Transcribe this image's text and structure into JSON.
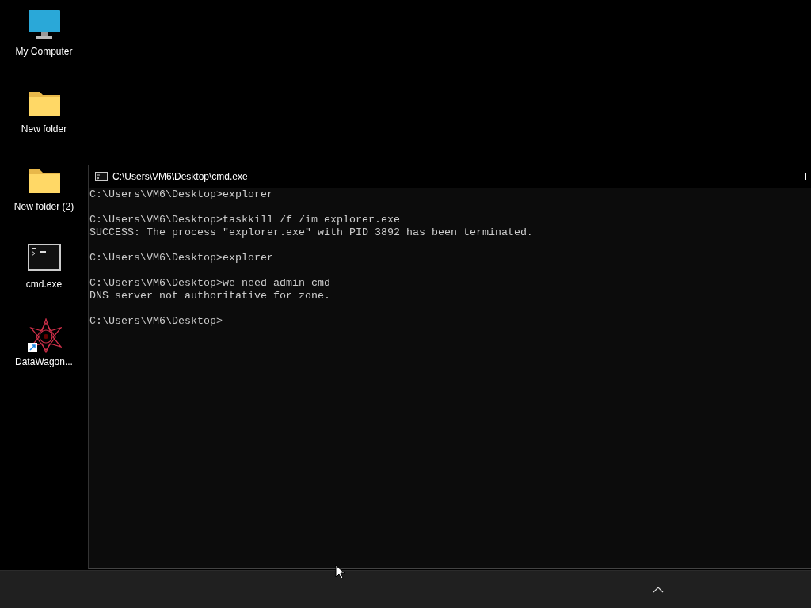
{
  "desktop_icons": [
    {
      "kind": "monitor",
      "label": "My Computer"
    },
    {
      "kind": "folder",
      "label": "New folder"
    },
    {
      "kind": "folder",
      "label": "New folder (2)"
    },
    {
      "kind": "terminal",
      "label": "cmd.exe"
    },
    {
      "kind": "shortcut",
      "label": "DataWagon..."
    }
  ],
  "window": {
    "title": "C:\\Users\\VM6\\Desktop\\cmd.exe",
    "blocks": [
      [
        "C:\\Users\\VM6\\Desktop>explorer"
      ],
      [
        "C:\\Users\\VM6\\Desktop>taskkill /f /im explorer.exe",
        "SUCCESS: The process \"explorer.exe\" with PID 3892 has been terminated."
      ],
      [
        "C:\\Users\\VM6\\Desktop>explorer"
      ],
      [
        "C:\\Users\\VM6\\Desktop>we need admin cmd",
        "DNS server not authoritative for zone."
      ],
      [
        "C:\\Users\\VM6\\Desktop>"
      ]
    ]
  }
}
